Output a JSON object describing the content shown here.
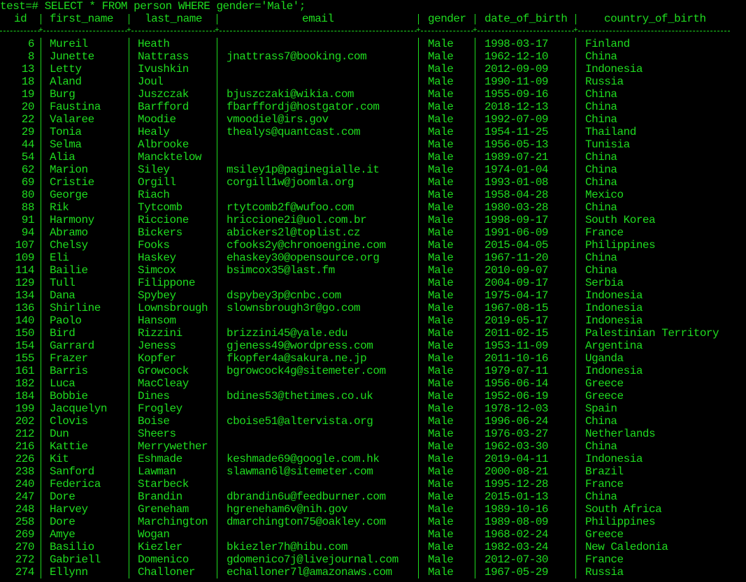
{
  "command": "test=# SELECT * FROM person WHERE gender='Male';",
  "columns": [
    "id",
    "first_name",
    "last_name",
    "email",
    "gender",
    "date_of_birth",
    "country_of_birth"
  ],
  "rows": [
    [
      "6",
      "Mureil",
      "Heath",
      "",
      "Male",
      "1998-03-17",
      "Finland"
    ],
    [
      "8",
      "Junette",
      "Nattrass",
      "jnattrass7@booking.com",
      "Male",
      "1962-12-10",
      "China"
    ],
    [
      "13",
      "Letty",
      "Ivushkin",
      "",
      "Male",
      "2012-09-09",
      "Indonesia"
    ],
    [
      "18",
      "Aland",
      "Joul",
      "",
      "Male",
      "1990-11-09",
      "Russia"
    ],
    [
      "19",
      "Burg",
      "Juszczak",
      "bjuszczaki@wikia.com",
      "Male",
      "1955-09-16",
      "China"
    ],
    [
      "20",
      "Faustina",
      "Barfford",
      "fbarffordj@hostgator.com",
      "Male",
      "2018-12-13",
      "China"
    ],
    [
      "22",
      "Valaree",
      "Moodie",
      "vmoodiel@irs.gov",
      "Male",
      "1992-07-09",
      "China"
    ],
    [
      "29",
      "Tonia",
      "Healy",
      "thealys@quantcast.com",
      "Male",
      "1954-11-25",
      "Thailand"
    ],
    [
      "44",
      "Selma",
      "Albrooke",
      "",
      "Male",
      "1956-05-13",
      "Tunisia"
    ],
    [
      "54",
      "Alia",
      "Mancktelow",
      "",
      "Male",
      "1989-07-21",
      "China"
    ],
    [
      "62",
      "Marion",
      "Siley",
      "msiley1p@paginegialle.it",
      "Male",
      "1974-01-04",
      "China"
    ],
    [
      "69",
      "Cristie",
      "Orgill",
      "corgill1w@joomla.org",
      "Male",
      "1993-01-08",
      "China"
    ],
    [
      "80",
      "George",
      "Riach",
      "",
      "Male",
      "1958-04-28",
      "Mexico"
    ],
    [
      "88",
      "Rik",
      "Tytcomb",
      "rtytcomb2f@wufoo.com",
      "Male",
      "1980-03-28",
      "China"
    ],
    [
      "91",
      "Harmony",
      "Riccione",
      "hriccione2i@uol.com.br",
      "Male",
      "1998-09-17",
      "South Korea"
    ],
    [
      "94",
      "Abramo",
      "Bickers",
      "abickers2l@toplist.cz",
      "Male",
      "1991-06-09",
      "France"
    ],
    [
      "107",
      "Chelsy",
      "Fooks",
      "cfooks2y@chronoengine.com",
      "Male",
      "2015-04-05",
      "Philippines"
    ],
    [
      "109",
      "Eli",
      "Haskey",
      "ehaskey30@opensource.org",
      "Male",
      "1967-11-20",
      "China"
    ],
    [
      "114",
      "Bailie",
      "Simcox",
      "bsimcox35@last.fm",
      "Male",
      "2010-09-07",
      "China"
    ],
    [
      "129",
      "Tull",
      "Filippone",
      "",
      "Male",
      "2004-09-17",
      "Serbia"
    ],
    [
      "134",
      "Dana",
      "Spybey",
      "dspybey3p@cnbc.com",
      "Male",
      "1975-04-17",
      "Indonesia"
    ],
    [
      "136",
      "Shirline",
      "Lownsbrough",
      "slownsbrough3r@go.com",
      "Male",
      "1967-08-15",
      "Indonesia"
    ],
    [
      "140",
      "Paolo",
      "Hansom",
      "",
      "Male",
      "2019-05-17",
      "Indonesia"
    ],
    [
      "150",
      "Bird",
      "Rizzini",
      "brizzini45@yale.edu",
      "Male",
      "2011-02-15",
      "Palestinian Territory"
    ],
    [
      "154",
      "Garrard",
      "Jeness",
      "gjeness49@wordpress.com",
      "Male",
      "1953-11-09",
      "Argentina"
    ],
    [
      "155",
      "Frazer",
      "Kopfer",
      "fkopfer4a@sakura.ne.jp",
      "Male",
      "2011-10-16",
      "Uganda"
    ],
    [
      "161",
      "Barris",
      "Growcock",
      "bgrowcock4g@sitemeter.com",
      "Male",
      "1979-07-11",
      "Indonesia"
    ],
    [
      "182",
      "Luca",
      "MacCleay",
      "",
      "Male",
      "1956-06-14",
      "Greece"
    ],
    [
      "184",
      "Bobbie",
      "Dines",
      "bdines53@thetimes.co.uk",
      "Male",
      "1952-06-19",
      "Greece"
    ],
    [
      "199",
      "Jacquelyn",
      "Frogley",
      "",
      "Male",
      "1978-12-03",
      "Spain"
    ],
    [
      "202",
      "Clovis",
      "Boise",
      "cboise51@altervista.org",
      "Male",
      "1996-06-24",
      "China"
    ],
    [
      "212",
      "Dun",
      "Sheers",
      "",
      "Male",
      "1976-03-27",
      "Netherlands"
    ],
    [
      "216",
      "Kattie",
      "Merrywether",
      "",
      "Male",
      "1962-03-30",
      "China"
    ],
    [
      "226",
      "Kit",
      "Eshmade",
      "keshmade69@google.com.hk",
      "Male",
      "2019-04-11",
      "Indonesia"
    ],
    [
      "238",
      "Sanford",
      "Lawman",
      "slawman6l@sitemeter.com",
      "Male",
      "2000-08-21",
      "Brazil"
    ],
    [
      "240",
      "Federica",
      "Starbeck",
      "",
      "Male",
      "1995-12-28",
      "France"
    ],
    [
      "247",
      "Dore",
      "Brandin",
      "dbrandin6u@feedburner.com",
      "Male",
      "2015-01-13",
      "China"
    ],
    [
      "248",
      "Harvey",
      "Greneham",
      "hgreneham6v@nih.gov",
      "Male",
      "1989-10-16",
      "South Africa"
    ],
    [
      "258",
      "Dore",
      "Marchington",
      "dmarchington75@oakley.com",
      "Male",
      "1989-08-09",
      "Philippines"
    ],
    [
      "269",
      "Amye",
      "Wogan",
      "",
      "Male",
      "1968-02-24",
      "Greece"
    ],
    [
      "270",
      "Basilio",
      "Kiezler",
      "bkiezler7h@hibu.com",
      "Male",
      "1982-03-24",
      "New Caledonia"
    ],
    [
      "272",
      "Gabriell",
      "Domenico",
      "gdomenico7j@livejournal.com",
      "Male",
      "2012-07-30",
      "France"
    ],
    [
      "274",
      "Ellynn",
      "Challoner",
      "echalloner7l@amazonaws.com",
      "Male",
      "1967-05-29",
      "Russia"
    ]
  ],
  "colors": {
    "background": "#000000",
    "text": "#1fdc1f"
  }
}
